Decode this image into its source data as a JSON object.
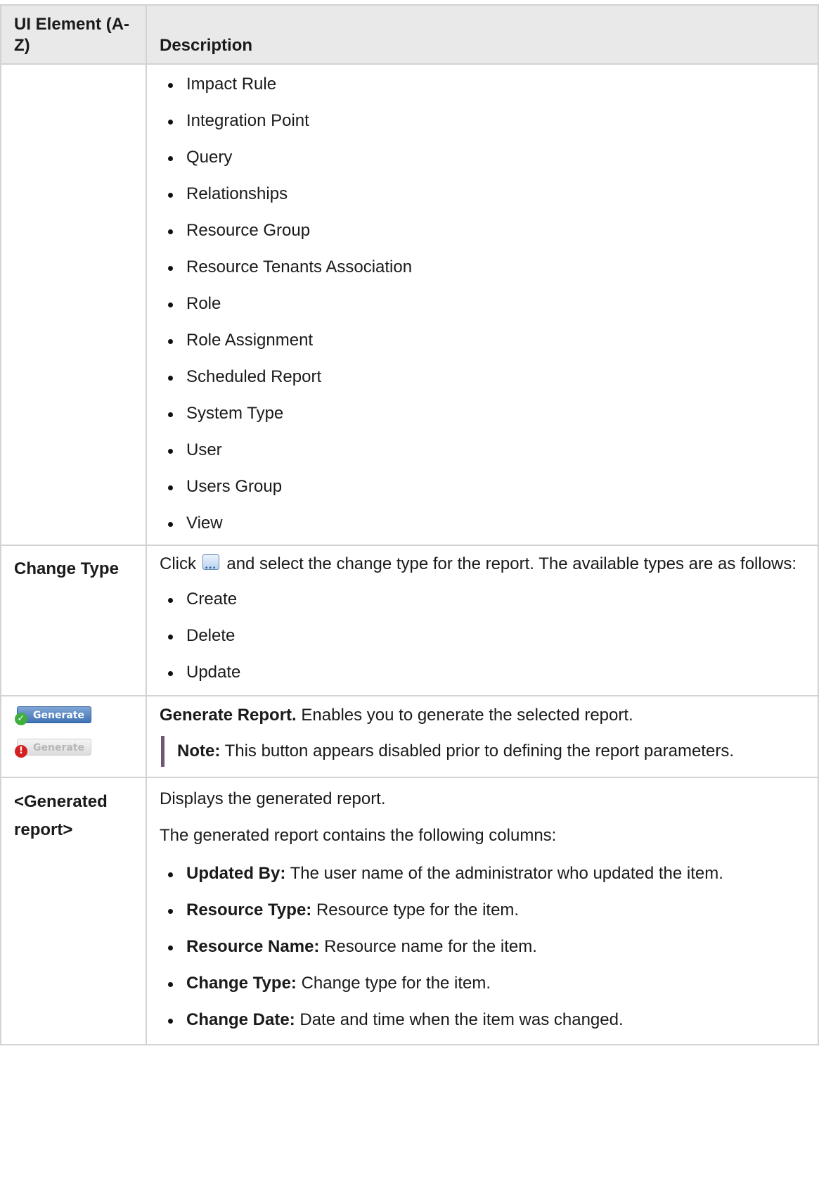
{
  "table": {
    "header": {
      "element": "UI Element (A-Z)",
      "description": "Description"
    },
    "resource_types": [
      "Impact Rule",
      "Integration Point",
      "Query",
      "Relationships",
      "Resource Group",
      "Resource Tenants Association",
      "Role",
      "Role Assignment",
      "Scheduled Report",
      "System Type",
      "User",
      "Users Group",
      "View"
    ],
    "change_type": {
      "label": "Change Type",
      "text_before": "Click",
      "button_icon": "ellipsis-button-icon",
      "text_after": "and select the change type for the report. The available types are as follows:",
      "types": [
        "Create",
        "Delete",
        "Update"
      ]
    },
    "generate": {
      "button_enabled_label": "Generate",
      "button_disabled_label": "Generate",
      "enabled_icon": "check-icon",
      "disabled_icon": "error-icon",
      "title": "Generate Report.",
      "text": "Enables you to generate the selected report.",
      "note_label": "Note:",
      "note_text": "This button appears disabled prior to defining the report parameters."
    },
    "generated_report": {
      "label": "<Generated report>",
      "intro": "Displays the generated report.",
      "columns_intro": "The generated report contains the following columns:",
      "columns": [
        {
          "name": "Updated By:",
          "desc": "The user name of the administrator who updated the item."
        },
        {
          "name": "Resource Type:",
          "desc": "Resource type for the item."
        },
        {
          "name": "Resource Name:",
          "desc": "Resource name for the item."
        },
        {
          "name": "Change Type:",
          "desc": "Change type for the item."
        },
        {
          "name": "Change Date:",
          "desc": "Date and time when the item was changed."
        }
      ]
    }
  }
}
